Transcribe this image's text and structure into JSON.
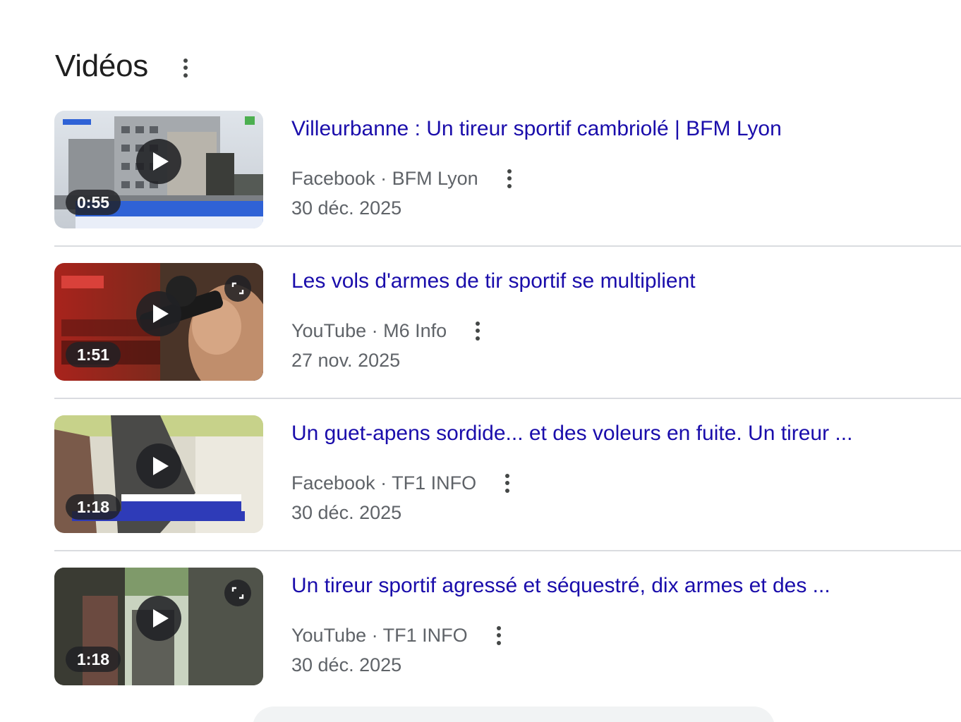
{
  "section": {
    "title": "Vidéos"
  },
  "videos": [
    {
      "title": "Villeurbanne : Un tireur sportif cambriolé | BFM Lyon",
      "source": "Facebook · BFM Lyon",
      "date": "30 déc. 2025",
      "duration": "0:55",
      "has_expand": false
    },
    {
      "title": "Les vols d'armes de tir sportif se multiplient",
      "source": "YouTube · M6 Info",
      "date": "27 nov. 2025",
      "duration": "1:51",
      "has_expand": true
    },
    {
      "title": "Un guet-apens sordide... et des voleurs en fuite. Un tireur ...",
      "source": "Facebook · TF1 INFO",
      "date": "30 déc. 2025",
      "duration": "1:18",
      "has_expand": false
    },
    {
      "title": "Un tireur sportif agressé et séquestré, dix armes et des ...",
      "source": "YouTube · TF1 INFO",
      "date": "30 déc. 2025",
      "duration": "1:18",
      "has_expand": true
    }
  ],
  "colors": {
    "link": "#1a0dab",
    "meta": "#5f6368",
    "divider": "#dadce0"
  },
  "icons": {
    "play": "play-icon",
    "expand": "expand-icon",
    "more": "more-vertical-icon"
  }
}
